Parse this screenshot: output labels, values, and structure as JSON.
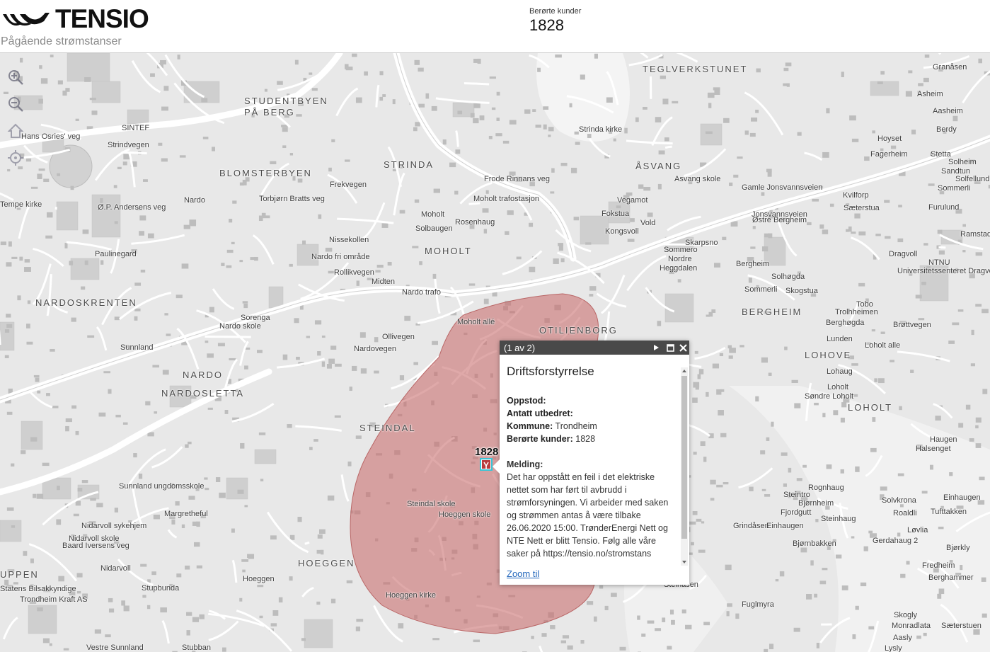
{
  "header": {
    "logo_text": "TENSIO",
    "subtitle": "Pågående strømstanser",
    "stat_label": "Berørte kunder",
    "stat_value": "1828"
  },
  "map": {
    "controls": [
      "zoom-in-icon",
      "zoom-out-icon",
      "home-icon",
      "locate-icon"
    ],
    "marker_count": "1828",
    "labels": [
      "TEGLVERKSTUNET",
      "STUDENTBYEN",
      "PÅ BERG",
      "STRINDA",
      "BLOMSTERBYEN",
      "ÅSVANG",
      "MOHOLT",
      "NARDOSKRENTEN",
      "NARDO",
      "NARDOSLETTA",
      "OTILIENBORG",
      "STEINDAL",
      "BERGHEIM",
      "LOHOVE",
      "LOHOLT",
      "HOEGGEN",
      "UPPEN",
      "Strinda kirke",
      "Moholt trafostasjon",
      "SINTEF",
      "Hans Osries' veg",
      "Strindvegen",
      "Nardo",
      "Nissekollen",
      "Rosenhaug",
      "Moholt",
      "Solbaugen",
      "Nardo fri område",
      "Midten",
      "Nardo trafo",
      "Paulinegard",
      "Sunnland",
      "Nardo skole",
      "Nidarvoll sykehjem",
      "Nidarvoll skole",
      "Nidarvoll",
      "Margretheful",
      "Sunnland ungdomsskole",
      "Steindal skole",
      "Hoeggen skole",
      "Hoeggen kirke",
      "Hoeggen",
      "Statens Bilsakkyndige",
      "Trondheim Kraft AS",
      "Stupbunda",
      "Vestre Sunnland",
      "Stubban",
      "Vegamot",
      "Fokstua",
      "Kongsvoll",
      "Vold",
      "Skarpsno",
      "Sommero",
      "Nordre",
      "Heggdalen",
      "Sommerli",
      "Solhøgda",
      "Skogstua",
      "Østre Bergheim",
      "Bergheim",
      "Trolhheimen",
      "Berghøgda",
      "Lunden",
      "Lohaug",
      "Loholt",
      "Søndre Loholt",
      "Loholt alle",
      "NTNU",
      "Universitetssenteret Dragvoll",
      "Dragvoll",
      "Tobo",
      "Granåsen",
      "Asheim",
      "Aasheim",
      "Hoyset",
      "Berdy",
      "Fagerheim",
      "Stetta",
      "Solheim",
      "Sandtun",
      "Solfellund",
      "Sommerli",
      "Kvilforp",
      "Sæterstua",
      "Furulund",
      "Ramstad",
      "Haugen",
      "Halsenget",
      "Rognhaug",
      "Steintro",
      "Bjørnheim",
      "Solvkrona",
      "Roaldli",
      "Einhaugen",
      "Grindåsen",
      "Einhaugen",
      "Tufttakken",
      "Løvlia",
      "Gerdahaug 2",
      "Bjørkly",
      "Fredheim",
      "Berghammer",
      "Steinåsen",
      "Fuglmyra",
      "Skogly",
      "Monradlata",
      "Aasly",
      "Lysly",
      "Sæterstuen",
      "Asvang skole",
      "Frode Rinnans veg",
      "Gamle Jonsvannsveien",
      "Jonsvannsveien",
      "Tempe kirke",
      "Ø.P. Andersens veg",
      "Baard Iversens veg",
      "Torbjørn Bratts veg",
      "Nardovegen",
      "Rollikvegen",
      "Moholt allé",
      "Ollivegen",
      "Brøttvegen",
      "Fjordgutt",
      "Steinhaug",
      "Sorenga",
      "Bjørnbakken",
      "Frekvegen"
    ]
  },
  "popup": {
    "pager": "(1 av 2)",
    "title": "Driftsforstyrrelse",
    "oppstod_label": "Oppstod:",
    "oppstod_value": "",
    "utbedret_label": "Antatt utbedret:",
    "utbedret_value": "",
    "kommune_label": "Kommune:",
    "kommune_value": "Trondheim",
    "kunder_label": "Berørte kunder:",
    "kunder_value": "1828",
    "melding_label": "Melding:",
    "melding_text": "Det har oppstått en feil i det elektriske nettet som har ført til avbrudd i strømforsyningen. Vi arbeider med saken og strømmen antas å være tilbake 26.06.2020 15:00. TrønderEnergi Nett og NTE Nett er blitt Tensio. Følg alle våre saker på https://tensio.no/stromstans",
    "zoom_link": "Zoom til"
  },
  "colors": {
    "outage_area": "#c96f6f",
    "popup_header": "#494949",
    "link": "#2266bb",
    "marker_border": "#39c5d6"
  }
}
